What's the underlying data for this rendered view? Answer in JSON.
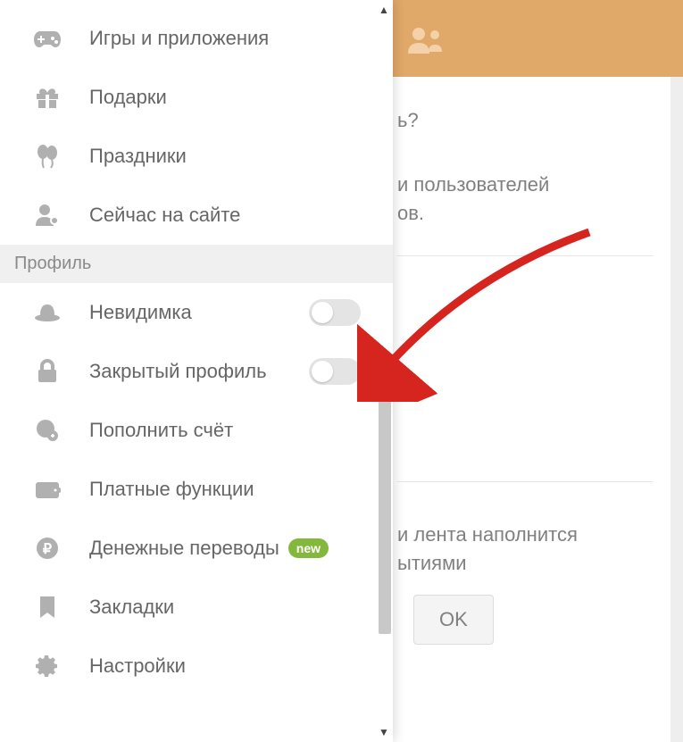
{
  "sidebar": {
    "section1_header_partial": "",
    "items_top": [
      {
        "label": "Игры и приложения",
        "icon": "gamepad-icon"
      },
      {
        "label": "Подарки",
        "icon": "gift-icon"
      },
      {
        "label": "Праздники",
        "icon": "balloons-icon"
      },
      {
        "label": "Сейчас на сайте",
        "icon": "user-online-icon"
      }
    ],
    "section2_header": "Профиль",
    "items_profile": [
      {
        "label": "Невидимка",
        "icon": "hat-icon",
        "has_toggle": true,
        "toggle_on": false
      },
      {
        "label": "Закрытый профиль",
        "icon": "lock-icon",
        "has_toggle": true,
        "toggle_on": false
      },
      {
        "label": "Пополнить счёт",
        "icon": "coin-plus-icon"
      },
      {
        "label": "Платные функции",
        "icon": "wallet-icon"
      },
      {
        "label": "Денежные переводы",
        "icon": "ruble-icon",
        "badge": "new"
      },
      {
        "label": "Закладки",
        "icon": "bookmark-icon"
      },
      {
        "label": "Настройки",
        "icon": "gear-icon"
      }
    ]
  },
  "content": {
    "question_partial": "ь?",
    "text1_partial": "и пользователей",
    "text2_partial": "ов.",
    "text3_partial": "и лента наполнится",
    "text4_partial": "ытиями",
    "ok_button": "OK"
  },
  "arrow_annotation": {
    "target": "Закрытый профиль toggle",
    "color": "#d6241e"
  }
}
